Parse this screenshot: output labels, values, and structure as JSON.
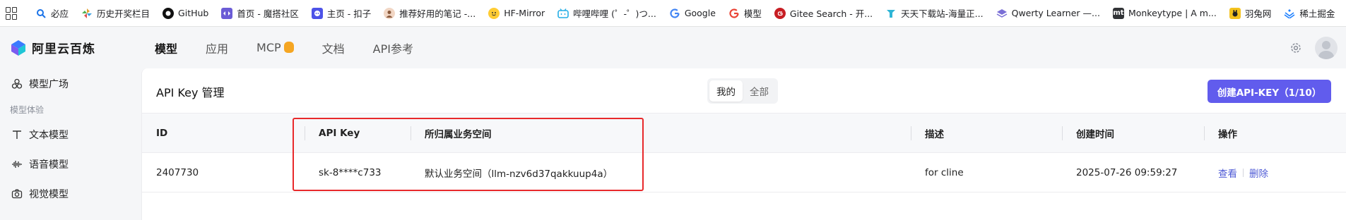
{
  "bookmarks": [
    {
      "label": "必应",
      "icon": "search-icon",
      "color": "#1a73e8"
    },
    {
      "label": "历史开奖栏目",
      "icon": "pinwheel-icon",
      "color": "#e0a030"
    },
    {
      "label": "GitHub",
      "icon": "github-icon",
      "color": "#111111"
    },
    {
      "label": "首页 - 魔搭社区",
      "icon": "modelscope-icon",
      "color": "#6b5cd6"
    },
    {
      "label": "主页 - 扣子",
      "icon": "coze-icon",
      "color": "#4d53e8"
    },
    {
      "label": "推荐好用的笔记 -...",
      "icon": "avatar-icon",
      "color": "#d88b63"
    },
    {
      "label": "HF-Mirror",
      "icon": "hf-icon",
      "color": "#ffcc33"
    },
    {
      "label": "哔哩哔哩 (゜-゜)つ...",
      "icon": "bilibili-icon",
      "color": "#23ade5"
    },
    {
      "label": "Google",
      "icon": "google-icon",
      "color": "#4285f4"
    },
    {
      "label": "模型",
      "icon": "google-icon",
      "color": "#ea4335"
    },
    {
      "label": "Gitee Search - 开...",
      "icon": "gitee-icon",
      "color": "#c71d23"
    },
    {
      "label": "天天下载站-海量正...",
      "icon": "download-site-icon",
      "color": "#2fb5d6"
    },
    {
      "label": "Qwerty Learner —...",
      "icon": "qwerty-icon",
      "color": "#7a6fd6"
    },
    {
      "label": "Monkeytype | A m...",
      "icon": "monkeytype-icon",
      "color": "#323437"
    },
    {
      "label": "羽兔网",
      "icon": "yutu-icon",
      "color": "#f4c21d"
    },
    {
      "label": "稀土掘金",
      "icon": "juejin-icon",
      "color": "#1e80ff"
    }
  ],
  "bookmark_icon_text": {
    "monkeytype": "mt"
  },
  "app": {
    "name": "阿里云百炼"
  },
  "topnav": [
    "模型",
    "应用",
    "MCP",
    "文档",
    "API参考"
  ],
  "sidebar": {
    "items_top": [
      {
        "label": "模型广场",
        "icon": "model-plaza-icon"
      }
    ],
    "group_label": "模型体验",
    "items": [
      {
        "label": "文本模型",
        "icon": "text-icon"
      },
      {
        "label": "语音模型",
        "icon": "audio-wave-icon"
      },
      {
        "label": "视觉模型",
        "icon": "camera-icon"
      }
    ]
  },
  "panel": {
    "title": "API Key 管理",
    "segment": [
      "我的",
      "全部"
    ],
    "create_button": "创建API-KEY（1/10）"
  },
  "table": {
    "headers": [
      "ID",
      "API Key",
      "所归属业务空间",
      "描述",
      "创建时间",
      "操作"
    ],
    "rows": [
      {
        "id": "2407730",
        "api_key": "sk-8****c733",
        "workspace": "默认业务空间（llm-nzv6d37qakkuup4a）",
        "description": "for cline",
        "created": "2025-07-26 09:59:27",
        "actions": [
          "查看",
          "删除"
        ]
      }
    ]
  },
  "colors": {
    "accent": "#615ced",
    "highlight": "#e8292b",
    "link": "#4f5bd5"
  }
}
